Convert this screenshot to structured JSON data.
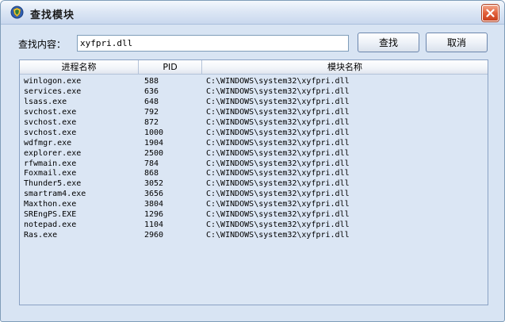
{
  "window": {
    "title": "查找模块",
    "icon": "app-shield-icon",
    "close_icon": "close-icon"
  },
  "search": {
    "label": "查找内容：",
    "value": "xyfpri.dll",
    "find_label": "查找",
    "cancel_label": "取消"
  },
  "table": {
    "columns": [
      "进程名称",
      "PID",
      "模块名称"
    ],
    "rows": [
      {
        "name": "winlogon.exe",
        "pid": "588",
        "module": "C:\\WINDOWS\\system32\\xyfpri.dll"
      },
      {
        "name": "services.exe",
        "pid": "636",
        "module": "C:\\WINDOWS\\system32\\xyfpri.dll"
      },
      {
        "name": "lsass.exe",
        "pid": "648",
        "module": "C:\\WINDOWS\\system32\\xyfpri.dll"
      },
      {
        "name": "svchost.exe",
        "pid": "792",
        "module": "C:\\WINDOWS\\system32\\xyfpri.dll"
      },
      {
        "name": "svchost.exe",
        "pid": "872",
        "module": "C:\\WINDOWS\\system32\\xyfpri.dll"
      },
      {
        "name": "svchost.exe",
        "pid": "1000",
        "module": "C:\\WINDOWS\\system32\\xyfpri.dll"
      },
      {
        "name": "wdfmgr.exe",
        "pid": "1904",
        "module": "C:\\WINDOWS\\system32\\xyfpri.dll"
      },
      {
        "name": "explorer.exe",
        "pid": "2500",
        "module": "C:\\WINDOWS\\system32\\xyfpri.dll"
      },
      {
        "name": "rfwmain.exe",
        "pid": "784",
        "module": "C:\\WINDOWS\\system32\\xyfpri.dll"
      },
      {
        "name": "Foxmail.exe",
        "pid": "868",
        "module": "C:\\WINDOWS\\system32\\xyfpri.dll"
      },
      {
        "name": "Thunder5.exe",
        "pid": "3052",
        "module": "C:\\WINDOWS\\system32\\xyfpri.dll"
      },
      {
        "name": "smartram4.exe",
        "pid": "3656",
        "module": "C:\\WINDOWS\\system32\\xyfpri.dll"
      },
      {
        "name": "Maxthon.exe",
        "pid": "3804",
        "module": "C:\\WINDOWS\\system32\\xyfpri.dll"
      },
      {
        "name": "SREngPS.EXE",
        "pid": "1296",
        "module": "C:\\WINDOWS\\system32\\xyfpri.dll"
      },
      {
        "name": "notepad.exe",
        "pid": "1104",
        "module": "C:\\WINDOWS\\system32\\xyfpri.dll"
      },
      {
        "name": "Ras.exe",
        "pid": "2960",
        "module": "C:\\WINDOWS\\system32\\xyfpri.dll"
      }
    ]
  }
}
